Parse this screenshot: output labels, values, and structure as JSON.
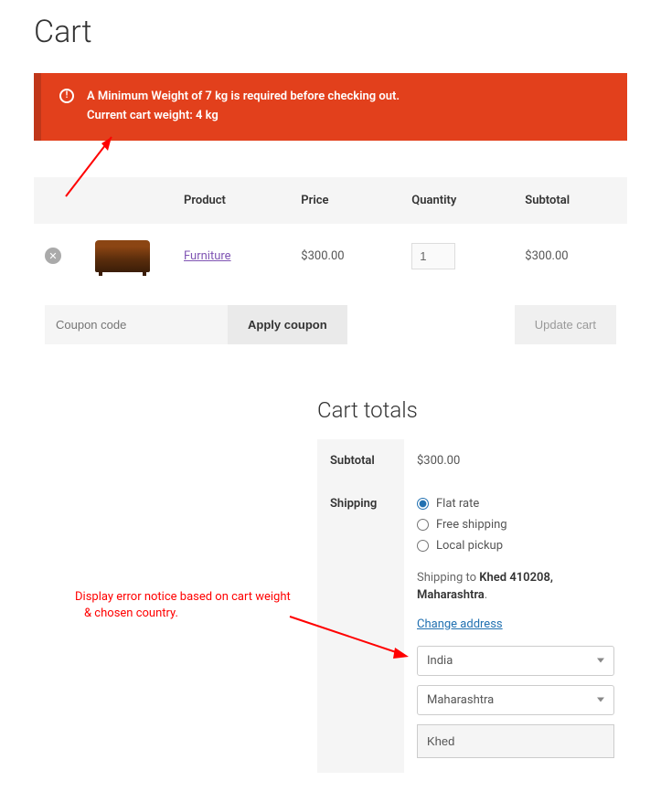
{
  "page_title": "Cart",
  "error": {
    "line1": "A Minimum Weight of 7 kg is required before checking out.",
    "line2": "Current cart weight: 4 kg"
  },
  "table": {
    "headers": {
      "product": "Product",
      "price": "Price",
      "qty": "Quantity",
      "subtotal": "Subtotal"
    },
    "row": {
      "name": "Furniture",
      "price": "$300.00",
      "qty": "1",
      "subtotal": "$300.00"
    }
  },
  "coupon": {
    "placeholder": "Coupon code",
    "apply": "Apply coupon",
    "update": "Update cart"
  },
  "totals": {
    "title": "Cart totals",
    "subtotal_label": "Subtotal",
    "subtotal": "$300.00",
    "shipping_label": "Shipping",
    "options": {
      "flat": "Flat rate",
      "free": "Free shipping",
      "local": "Local pickup"
    },
    "dest_prefix": "Shipping to ",
    "dest_bold": "Khed 410208, Maharashtra",
    "dest_suffix": ".",
    "change": "Change address",
    "country": "India",
    "state": "Maharashtra",
    "city": "Khed"
  },
  "annotation": {
    "line1": "Display error notice based on cart weight",
    "line2": "& chosen country."
  }
}
